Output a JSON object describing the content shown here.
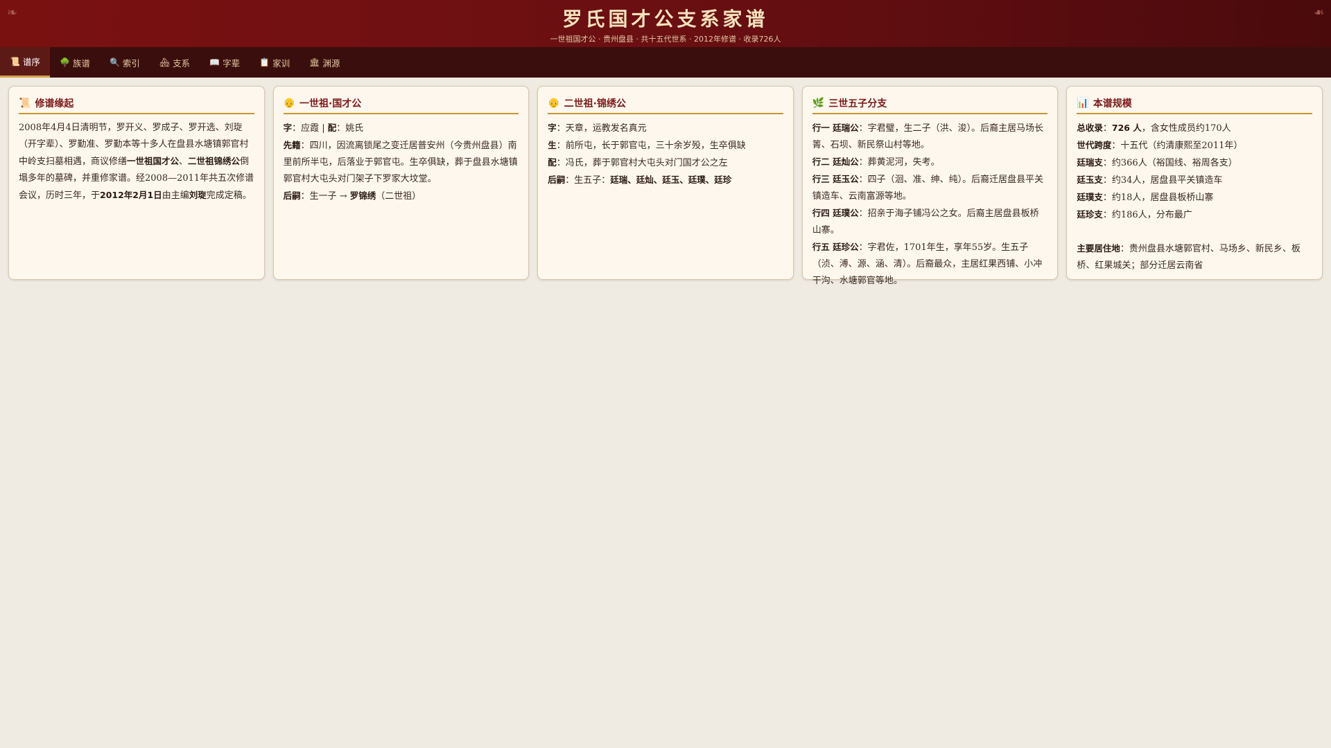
{
  "header": {
    "title": "罗氏国才公支系家谱",
    "subtitle": "一世祖国才公 · 贵州盘县 · 共十五代世系 · 2012年修谱 · 收录726人",
    "ornament": "❧"
  },
  "nav": {
    "tabs": [
      {
        "icon": "📜",
        "label": "谱序",
        "active": true
      },
      {
        "icon": "🌳",
        "label": "族谱"
      },
      {
        "icon": "🔍",
        "label": "索引"
      },
      {
        "icon": "🏘",
        "label": "支系"
      },
      {
        "icon": "📖",
        "label": "字辈"
      },
      {
        "icon": "📋",
        "label": "家训"
      },
      {
        "icon": "🏛",
        "label": "渊源"
      }
    ]
  },
  "cards": {
    "c1": {
      "icon": "📜",
      "title": "修谱缘起",
      "p1": "2008年4月4日清明节，罗开义、罗成子、罗开选、刘琁（开字辈）、罗勤准、罗勤本等十多人在盘县水塘镇郭官村中岭支扫墓相遇，商议修缮",
      "b1": "一世祖国才公",
      "p2": "、",
      "b2": "二世祖锦绣公",
      "p3": "倒塌多年的墓碑，并重修家谱。经2008—2011年共五次修谱会议，历时三年，于",
      "b3": "2012年2月1日",
      "p4": "由主编",
      "b4": "刘琁",
      "p5": "完成定稿。"
    },
    "c2": {
      "icon": "👴",
      "title": "一世祖·国才公",
      "l1_k1": "字",
      "l1_v1": "：应霞 | ",
      "l1_k2": "配",
      "l1_v2": "：姚氏",
      "l2_k": "先籍",
      "l2_v": "：四川，因流离锁尾之变迁居普安州（今贵州盘县）南里前所半屯，后落业于郭官屯。生卒俱缺，葬于盘县水塘镇郭官村大屯头对门架子下罗家大坟堂。",
      "l3_k": "后嗣",
      "l3_v": "：生一子 → ",
      "l3_b": "罗锦绣",
      "l3_v2": "（二世祖）"
    },
    "c3": {
      "icon": "👴",
      "title": "二世祖·锦绣公",
      "l1_k": "字",
      "l1_v": "：天章，运教发名真元",
      "l2_k": "生",
      "l2_v": "：前所屯，长于郭官屯，三十余岁殁，生卒俱缺",
      "l3_k": "配",
      "l3_v": "：冯氏，葬于郭官村大屯头对门国才公之左",
      "l4_k": "后嗣",
      "l4_v": "：生五子：",
      "l4_b": "廷瑞、廷灿、廷玉、廷璞、廷珍"
    },
    "c4": {
      "icon": "🌿",
      "title": "三世五子分支",
      "l1_k": "行一 廷瑞公",
      "l1_v": "：字君璧，生二子（洪、浚）。后裔主居马场长箐、石坝、新民祭山村等地。",
      "l2_k": "行二 廷灿公",
      "l2_v": "：葬黄泥河，失考。",
      "l3_k": "行三 廷玉公",
      "l3_v": "：四子（洄、准、绅、纯）。后裔迁居盘县平关镇造车、云南富源等地。",
      "l4_k": "行四 廷璞公",
      "l4_v": "：招亲于海子铺冯公之女。后裔主居盘县板桥山寨。",
      "l5_k": "行五 廷珍公",
      "l5_v": "：字君佐，1701年生，享年55岁。生五子（浈、溥、源、涵、清）。后裔最众，主居红果西铺、小冲干沟、水塘郭官等地。"
    },
    "c5": {
      "icon": "📊",
      "title": "本谱规模",
      "l1_k": "总收录",
      "l1_m": "：",
      "l1_b": "726 人",
      "l1_v": "，含女性成员约170人",
      "l2_k": "世代跨度",
      "l2_v": "：十五代（约清康熙至2011年）",
      "l3_k": "廷瑞支",
      "l3_v": "：约366人（裕国线、裕周各支）",
      "l4_k": "廷玉支",
      "l4_v": "：约34人，居盘县平关镇造车",
      "l5_k": "廷璞支",
      "l5_v": "：约18人，居盘县板桥山寨",
      "l6_k": "廷珍支",
      "l6_v": "：约186人，分布最广",
      "l7_k": "主要居住地",
      "l7_v": "：贵州盘县水塘郭官村、马场乡、新民乡、板桥、红果城关；部分迁居云南省"
    }
  }
}
